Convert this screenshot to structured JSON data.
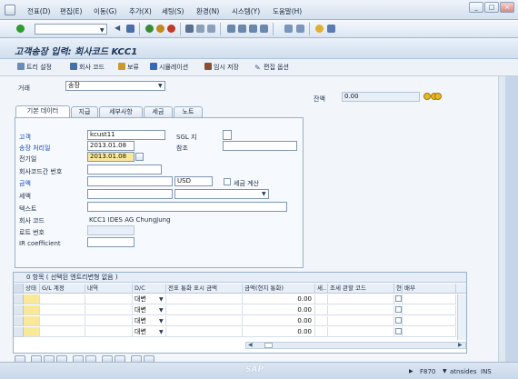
{
  "menu": {
    "items": [
      "전표(D)",
      "편집(E)",
      "이동(G)",
      "추가(X)",
      "세팅(S)",
      "환경(N)",
      "시스템(Y)",
      "도움말(H)"
    ]
  },
  "window": {
    "minimize": "_",
    "maximize": "□",
    "close": "×"
  },
  "toolbar": {
    "command_value": ""
  },
  "title": "고객송장 입력: 회사코드 KCC1",
  "app_toolbar": {
    "tree_settings": "트리 설정",
    "company_code": "회사 코드",
    "hold": "보류",
    "simulate": "시뮬레이션",
    "park": "임시 저장",
    "edit_options": "편집 옵션"
  },
  "transaction": {
    "label": "거래",
    "value": "송장"
  },
  "balance": {
    "label": "잔액",
    "value": "0.00"
  },
  "tabs": [
    "기본 데이터",
    "지급",
    "세부사항",
    "세금",
    "노트"
  ],
  "form": {
    "customer_label": "고객",
    "customer_value": "kcust11",
    "sgl_label": "SGL 지",
    "invoice_date_label": "송장 처리일",
    "invoice_date_value": "2013.01.08",
    "reference_label": "참조",
    "posting_date_label": "전기일",
    "posting_date_value": "2013.01.08",
    "cross_cc_label": "회사코드간 번호",
    "amount_label": "금액",
    "currency_value": "USD",
    "calc_tax_label": "세금 계산",
    "tax_label": "세액",
    "text_label": "텍스트",
    "company_code_label": "회사 코드",
    "company_code_value": "KCC1 IDES AG ChungJung",
    "lot_label": "로트 번호",
    "ir_label": "IR coefficient"
  },
  "table": {
    "title": "0 항목 ( 선택된 엔트리변형 없음 )",
    "headers": [
      "상태",
      "G/L 계정",
      "내역",
      "D/C",
      "전표 통화 표시 금액",
      "금액(현지 통화)",
      "세..",
      "조세 관할 코드",
      "현",
      "배부"
    ],
    "rows": [
      {
        "dc": "대변",
        "amount_local": "0.00"
      },
      {
        "dc": "대변",
        "amount_local": "0.00"
      },
      {
        "dc": "대변",
        "amount_local": "0.00"
      },
      {
        "dc": "대변",
        "amount_local": "0.00"
      }
    ]
  },
  "status": {
    "system": "F870",
    "server": "atnsides",
    "mode": "INS"
  },
  "colors": {
    "accent": "#1447c0",
    "required": "#f9e89a",
    "background": "#c6d6e8"
  }
}
